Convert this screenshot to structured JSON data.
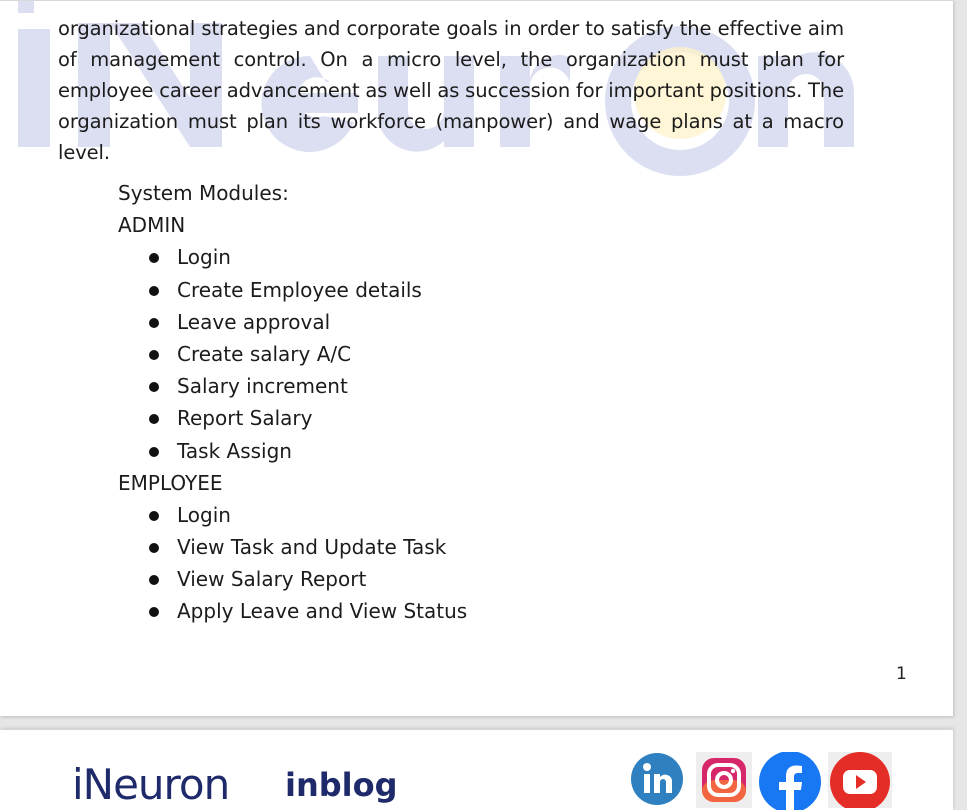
{
  "document": {
    "paragraph": "organizational strategies and corporate goals in order to satisfy the effective aim of management control. On a micro level, the organization must plan for employee career advancement as well as succession for important positions. The organization must plan its workforce (manpower) and wage plans at a macro level.",
    "modules_heading": "System Modules:",
    "admin": {
      "heading": "ADMIN",
      "items": [
        "Login",
        "Create Employee details",
        "Leave approval",
        "Create salary A/C",
        "Salary increment",
        "Report Salary",
        "Task Assign"
      ]
    },
    "employee": {
      "heading": "EMPLOYEE",
      "items": [
        "Login",
        "View Task and Update Task",
        "View Salary Report",
        "Apply Leave and View Status"
      ]
    },
    "page_number": "1"
  },
  "watermark": {
    "text": "iNeuron"
  },
  "footer": {
    "brand_logo": "iNeuron",
    "blog_logo": "inblog",
    "social_icons": [
      "linkedin-icon",
      "instagram-icon",
      "facebook-icon",
      "youtube-icon"
    ]
  },
  "colors": {
    "watermark": "#dcdff2",
    "watermark_accent": "#fdf3c8",
    "logo_navy": "#1f2a6b",
    "linkedin": "#2f80c0",
    "facebook": "#1877f2",
    "youtube": "#e52d27"
  }
}
